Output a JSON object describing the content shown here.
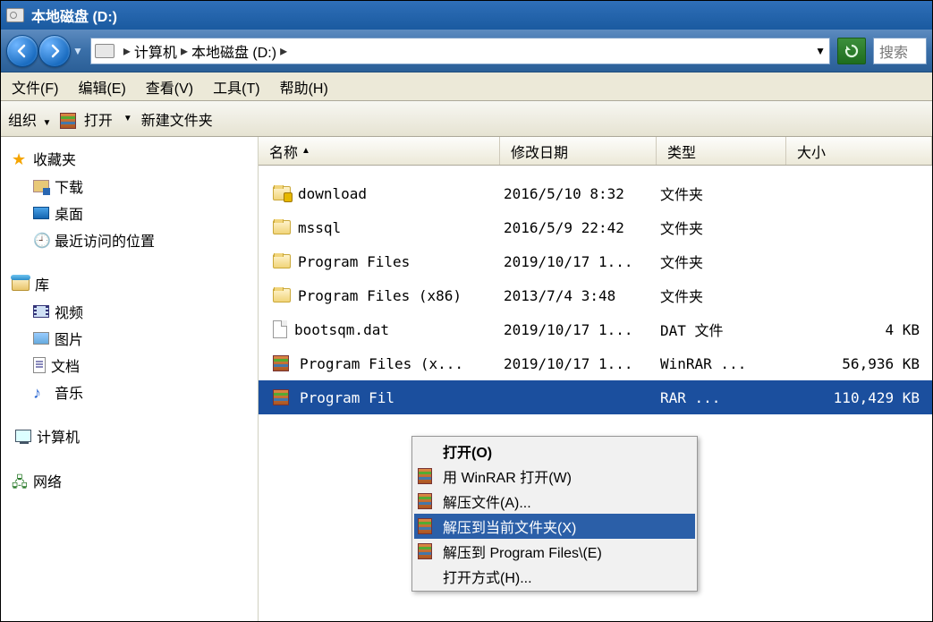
{
  "title": "本地磁盘 (D:)",
  "nav": {
    "crumb1": "计算机",
    "crumb2": "本地磁盘 (D:)"
  },
  "search": {
    "placeholder": "搜索"
  },
  "menubar": {
    "file": "文件(F)",
    "edit": "编辑(E)",
    "view": "查看(V)",
    "tools": "工具(T)",
    "help": "帮助(H)"
  },
  "toolbar": {
    "organize": "组织",
    "open": "打开",
    "newfolder": "新建文件夹"
  },
  "sidebar": {
    "fav": "收藏夹",
    "downloads": "下载",
    "desktop": "桌面",
    "recent": "最近访问的位置",
    "libraries": "库",
    "video": "视频",
    "pictures": "图片",
    "docs": "文档",
    "music": "音乐",
    "computer": "计算机",
    "network": "网络"
  },
  "columns": {
    "name": "名称",
    "modified": "修改日期",
    "type": "类型",
    "size": "大小"
  },
  "rows": [
    {
      "icon": "folder-lock",
      "name": "download",
      "date": "2016/5/10 8:32",
      "type": "文件夹",
      "size": "",
      "sel": false
    },
    {
      "icon": "folder",
      "name": "mssql",
      "date": "2016/5/9 22:42",
      "type": "文件夹",
      "size": "",
      "sel": false
    },
    {
      "icon": "folder",
      "name": "Program Files",
      "date": "2019/10/17 1...",
      "type": "文件夹",
      "size": "",
      "sel": false
    },
    {
      "icon": "folder",
      "name": "Program Files (x86)",
      "date": "2013/7/4 3:48",
      "type": "文件夹",
      "size": "",
      "sel": false
    },
    {
      "icon": "file",
      "name": "bootsqm.dat",
      "date": "2019/10/17 1...",
      "type": "DAT 文件",
      "size": "4 KB",
      "sel": false
    },
    {
      "icon": "rar",
      "name": "Program Files (x...",
      "date": "2019/10/17 1...",
      "type": "WinRAR ...",
      "size": "56,936 KB",
      "sel": false
    },
    {
      "icon": "rar",
      "name": "Program Fil",
      "date": "",
      "type": "RAR ...",
      "size": "110,429 KB",
      "sel": true
    }
  ],
  "ctx": {
    "open": "打开(O)",
    "openwinrar": "用 WinRAR 打开(W)",
    "extractfiles": "解压文件(A)...",
    "extracthere": "解压到当前文件夹(X)",
    "extractto": "解压到 Program Files\\(E)",
    "openwith": "打开方式(H)..."
  }
}
